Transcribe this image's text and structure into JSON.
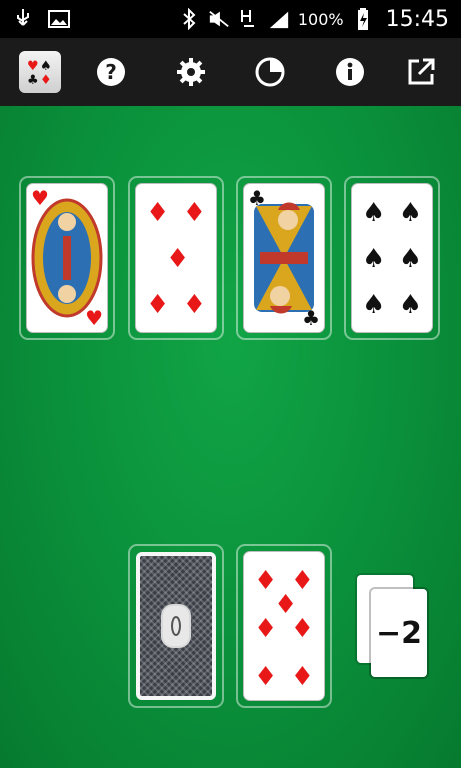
{
  "statusbar": {
    "icons_left": [
      "usb-icon",
      "image-icon"
    ],
    "icons_right": [
      "bluetooth-icon",
      "mute-icon",
      "signal-h-icon",
      "signal-bars-icon",
      "battery-charging-icon"
    ],
    "battery": "100%",
    "time": "15:45"
  },
  "toolbar": {
    "buttons": [
      {
        "name": "app-logo-icon",
        "glyph": "♥♠♣♦"
      },
      {
        "name": "help-icon",
        "glyph": "?"
      },
      {
        "name": "settings-icon",
        "glyph": "⚙"
      },
      {
        "name": "stats-pie-icon",
        "glyph": "◔"
      },
      {
        "name": "info-icon",
        "glyph": "i"
      },
      {
        "name": "share-external-icon",
        "glyph": "↗"
      }
    ]
  },
  "foundation": [
    {
      "rank": "K",
      "suit": "hearts",
      "face": "king",
      "color": "#e81818"
    },
    {
      "rank": "5",
      "suit": "diamonds",
      "face": "pips",
      "color": "#e81818"
    },
    {
      "rank": "K",
      "suit": "clubs",
      "face": "king",
      "color": "#111111"
    },
    {
      "rank": "6",
      "suit": "spades",
      "face": "pips",
      "color": "#111111"
    }
  ],
  "stock": {
    "face": "back"
  },
  "waste": {
    "rank": "7",
    "suit": "diamonds",
    "color": "#e81818"
  },
  "penalty": {
    "label": "−2"
  }
}
